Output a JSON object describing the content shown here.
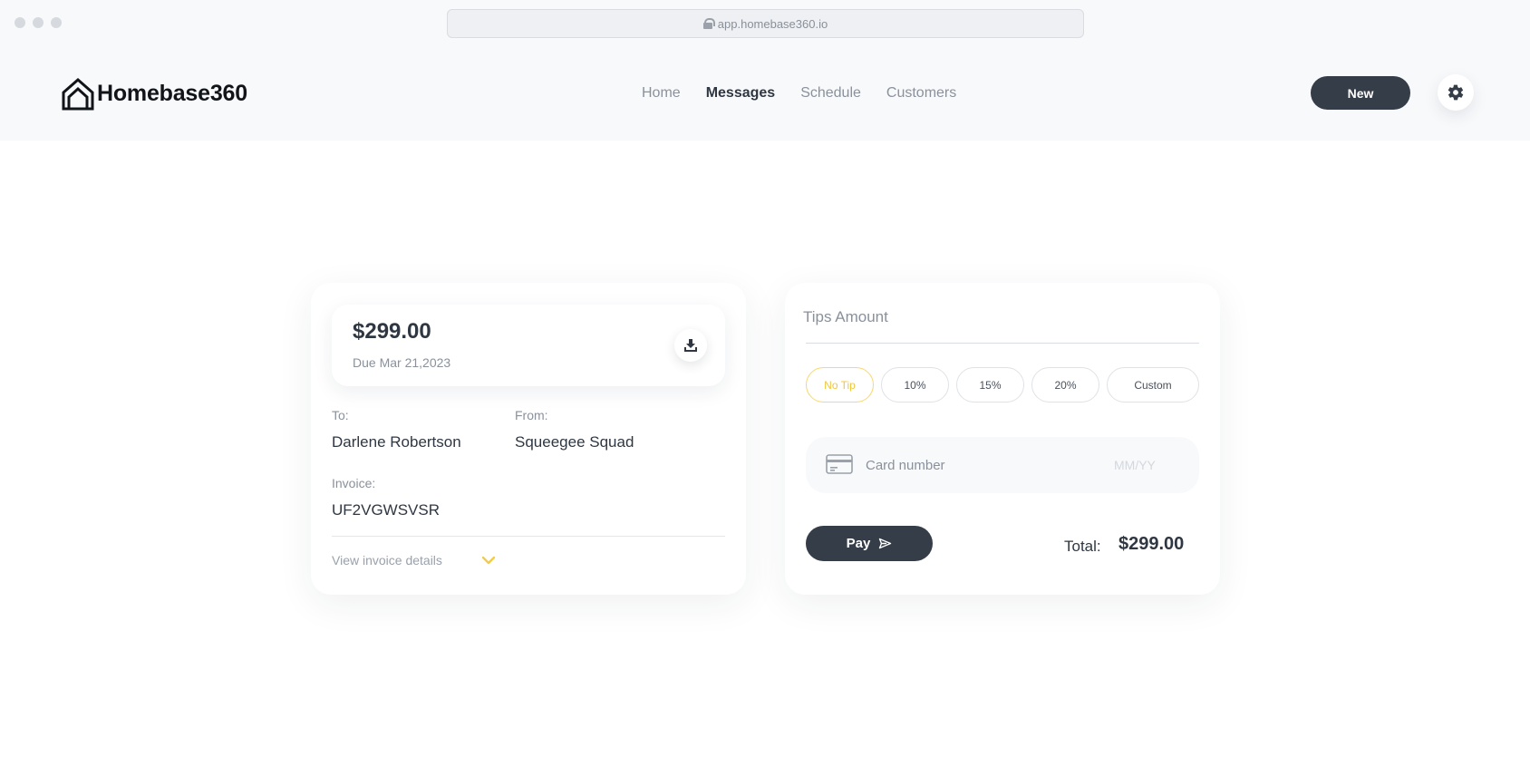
{
  "browser": {
    "url": "app.homebase360.io"
  },
  "header": {
    "brand": "Homebase360",
    "nav": [
      {
        "label": "Home",
        "active": false
      },
      {
        "label": "Messages",
        "active": true
      },
      {
        "label": "Schedule",
        "active": false
      },
      {
        "label": "Customers",
        "active": false
      }
    ],
    "new_label": "New",
    "settings_icon": "gear-icon"
  },
  "invoice": {
    "amount": "$299.00",
    "due": "Due Mar 21,2023",
    "download_icon": "download-icon",
    "to_label": "To:",
    "to_value": "Darlene Robertson",
    "from_label": "From:",
    "from_value": "Squeegee Squad",
    "invoice_label": "Invoice:",
    "invoice_value": "UF2VGWSVSR",
    "details_link": "View invoice details"
  },
  "payment": {
    "tips_title": "Tips Amount",
    "tips": [
      {
        "label": "No Tip",
        "selected": true
      },
      {
        "label": "10%",
        "selected": false
      },
      {
        "label": "15%",
        "selected": false
      },
      {
        "label": "20%",
        "selected": false
      },
      {
        "label": "Custom",
        "selected": false
      }
    ],
    "card_placeholder": "Card number",
    "card_value": "",
    "expiry_placeholder": "MM/YY",
    "expiry_value": "",
    "pay_label": "Pay",
    "total_label": "Total:",
    "total_value": "$299.00"
  },
  "colors": {
    "accent_dark": "#353d48",
    "accent_yellow": "#efc73e",
    "header_bg": "#f8f9fb"
  }
}
